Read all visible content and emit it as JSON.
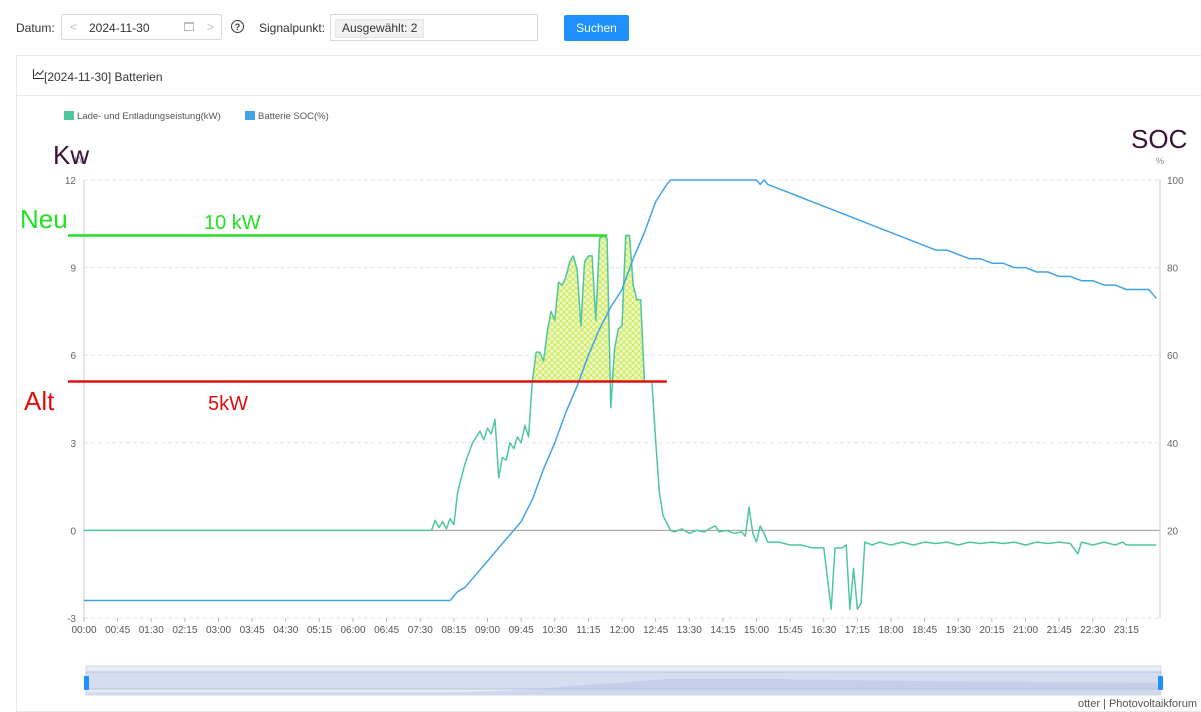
{
  "toolbar": {
    "date_label": "Datum",
    "date_value": "2024-11-30",
    "signal_label": "Signalpunkt",
    "signal_tag": "Ausgewählt: 2",
    "search_button": "Suchen"
  },
  "card": {
    "title": "[2024-11-30] Batterien"
  },
  "footer": "otter | Photovoltaikforum",
  "colors": {
    "power": "#4fc6a0",
    "soc": "#41a4e8",
    "accent_button": "#1e90ff",
    "new_line": "#22e022",
    "old_line": "#e01010",
    "hatch": "#c8e84a"
  },
  "chart_data": {
    "type": "line",
    "legend": [
      "Lade- und Entladungseistung(kW)",
      "Batterie SOC(%)"
    ],
    "legend_position": "top-left",
    "left_axis_units": "kW",
    "right_axis_units": "%",
    "overlay_left_title": "Kw",
    "overlay_right_title": "SOC",
    "ylim_left": [
      -3,
      12
    ],
    "ylim_right": [
      0,
      100
    ],
    "yticks_left": [
      -3,
      0,
      3,
      6,
      9,
      12
    ],
    "yticks_right": [
      20,
      40,
      60,
      80,
      100
    ],
    "xticks": [
      "00:00",
      "00:45",
      "01:30",
      "02:15",
      "03:00",
      "03:45",
      "04:30",
      "05:15",
      "06:00",
      "06:45",
      "07:30",
      "08:15",
      "09:00",
      "09:45",
      "10:30",
      "11:15",
      "12:00",
      "12:45",
      "13:30",
      "14:15",
      "15:00",
      "15:45",
      "16:30",
      "17:15",
      "18:00",
      "18:45",
      "19:30",
      "20:15",
      "21:00",
      "21:45",
      "22:30",
      "23:15"
    ],
    "grid": "horizontal dashed",
    "series": [
      {
        "name": "Lade- und Entladungseistung(kW)",
        "axis": "left",
        "points": [
          [
            "00:00",
            0
          ],
          [
            "07:45",
            0
          ],
          [
            "07:50",
            0.35
          ],
          [
            "07:55",
            0.1
          ],
          [
            "08:00",
            0.3
          ],
          [
            "08:05",
            0.05
          ],
          [
            "08:10",
            0.4
          ],
          [
            "08:15",
            0.2
          ],
          [
            "08:20",
            1.3
          ],
          [
            "08:30",
            2.3
          ],
          [
            "08:40",
            3.0
          ],
          [
            "08:50",
            3.4
          ],
          [
            "08:55",
            3.1
          ],
          [
            "09:00",
            3.5
          ],
          [
            "09:05",
            3.3
          ],
          [
            "09:10",
            3.8
          ],
          [
            "09:15",
            1.8
          ],
          [
            "09:20",
            2.5
          ],
          [
            "09:25",
            2.4
          ],
          [
            "09:30",
            3.0
          ],
          [
            "09:35",
            2.8
          ],
          [
            "09:40",
            3.2
          ],
          [
            "09:45",
            3.0
          ],
          [
            "09:50",
            3.6
          ],
          [
            "09:55",
            3.2
          ],
          [
            "10:00",
            5.1
          ],
          [
            "10:05",
            6.1
          ],
          [
            "10:10",
            6.1
          ],
          [
            "10:15",
            5.8
          ],
          [
            "10:20",
            6.8
          ],
          [
            "10:25",
            7.5
          ],
          [
            "10:30",
            7.2
          ],
          [
            "10:35",
            8.5
          ],
          [
            "10:40",
            8.4
          ],
          [
            "10:45",
            8.7
          ],
          [
            "10:50",
            9.2
          ],
          [
            "10:55",
            9.4
          ],
          [
            "11:00",
            8.9
          ],
          [
            "11:05",
            7.0
          ],
          [
            "11:10",
            9.2
          ],
          [
            "11:15",
            9.4
          ],
          [
            "11:20",
            9.4
          ],
          [
            "11:25",
            7.2
          ],
          [
            "11:30",
            10.0
          ],
          [
            "11:35",
            10.1
          ],
          [
            "11:40",
            10.0
          ],
          [
            "11:45",
            4.2
          ],
          [
            "11:50",
            6.2
          ],
          [
            "11:55",
            6.9
          ],
          [
            "12:00",
            7.0
          ],
          [
            "12:05",
            10.1
          ],
          [
            "12:10",
            10.1
          ],
          [
            "12:15",
            8.4
          ],
          [
            "12:20",
            7.9
          ],
          [
            "12:25",
            7.9
          ],
          [
            "12:30",
            5.1
          ],
          [
            "12:40",
            5.1
          ],
          [
            "12:45",
            3.1
          ],
          [
            "12:50",
            1.3
          ],
          [
            "12:55",
            0.5
          ],
          [
            "13:05",
            0
          ],
          [
            "13:10",
            -0.05
          ],
          [
            "13:20",
            0.05
          ],
          [
            "13:30",
            -0.1
          ],
          [
            "13:40",
            0
          ],
          [
            "13:50",
            -0.05
          ],
          [
            "14:00",
            0.1
          ],
          [
            "14:05",
            0.15
          ],
          [
            "14:10",
            -0.05
          ],
          [
            "14:20",
            0
          ],
          [
            "14:30",
            -0.1
          ],
          [
            "14:40",
            -0.05
          ],
          [
            "14:45",
            -0.2
          ],
          [
            "14:50",
            0.8
          ],
          [
            "14:55",
            -0.1
          ],
          [
            "15:00",
            -0.4
          ],
          [
            "15:05",
            0.15
          ],
          [
            "15:10",
            -0.1
          ],
          [
            "15:15",
            -0.4
          ],
          [
            "15:30",
            -0.4
          ],
          [
            "15:45",
            -0.5
          ],
          [
            "16:00",
            -0.5
          ],
          [
            "16:15",
            -0.6
          ],
          [
            "16:30",
            -0.6
          ],
          [
            "16:40",
            -2.7
          ],
          [
            "16:45",
            -0.6
          ],
          [
            "16:55",
            -0.6
          ],
          [
            "17:00",
            -0.5
          ],
          [
            "17:05",
            -2.7
          ],
          [
            "17:10",
            -1.3
          ],
          [
            "17:15",
            -2.7
          ],
          [
            "17:20",
            -2.5
          ],
          [
            "17:25",
            -0.4
          ],
          [
            "17:35",
            -0.5
          ],
          [
            "17:45",
            -0.4
          ],
          [
            "18:00",
            -0.5
          ],
          [
            "18:15",
            -0.4
          ],
          [
            "18:30",
            -0.5
          ],
          [
            "18:45",
            -0.4
          ],
          [
            "19:00",
            -0.45
          ],
          [
            "19:15",
            -0.4
          ],
          [
            "19:30",
            -0.5
          ],
          [
            "19:45",
            -0.4
          ],
          [
            "20:00",
            -0.45
          ],
          [
            "20:15",
            -0.4
          ],
          [
            "20:30",
            -0.45
          ],
          [
            "20:45",
            -0.4
          ],
          [
            "21:00",
            -0.5
          ],
          [
            "21:15",
            -0.4
          ],
          [
            "21:30",
            -0.45
          ],
          [
            "21:45",
            -0.4
          ],
          [
            "22:00",
            -0.45
          ],
          [
            "22:10",
            -0.8
          ],
          [
            "22:15",
            -0.4
          ],
          [
            "22:30",
            -0.5
          ],
          [
            "22:45",
            -0.4
          ],
          [
            "23:00",
            -0.5
          ],
          [
            "23:10",
            -0.4
          ],
          [
            "23:15",
            -0.5
          ],
          [
            "23:30",
            -0.5
          ],
          [
            "23:55",
            -0.5
          ]
        ]
      },
      {
        "name": "Batterie SOC(%)",
        "axis": "right",
        "points": [
          [
            "00:00",
            4
          ],
          [
            "08:10",
            4
          ],
          [
            "08:20",
            6
          ],
          [
            "08:30",
            7
          ],
          [
            "08:45",
            10
          ],
          [
            "09:00",
            13
          ],
          [
            "09:15",
            16
          ],
          [
            "09:30",
            19
          ],
          [
            "09:45",
            22
          ],
          [
            "10:00",
            27
          ],
          [
            "10:15",
            34
          ],
          [
            "10:30",
            40
          ],
          [
            "10:45",
            47
          ],
          [
            "11:00",
            53
          ],
          [
            "11:15",
            60
          ],
          [
            "11:30",
            66
          ],
          [
            "11:45",
            71
          ],
          [
            "12:00",
            75
          ],
          [
            "12:15",
            82
          ],
          [
            "12:30",
            88
          ],
          [
            "12:45",
            95
          ],
          [
            "13:00",
            99
          ],
          [
            "13:05",
            100
          ],
          [
            "14:00",
            100
          ],
          [
            "15:00",
            100
          ],
          [
            "15:05",
            99
          ],
          [
            "15:10",
            100
          ],
          [
            "15:15",
            99
          ],
          [
            "15:30",
            98
          ],
          [
            "15:45",
            97
          ],
          [
            "16:00",
            96
          ],
          [
            "16:15",
            95
          ],
          [
            "16:30",
            94
          ],
          [
            "16:45",
            93
          ],
          [
            "17:00",
            92
          ],
          [
            "17:15",
            91
          ],
          [
            "17:30",
            90
          ],
          [
            "17:45",
            89
          ],
          [
            "18:00",
            88
          ],
          [
            "18:15",
            87
          ],
          [
            "18:30",
            86
          ],
          [
            "18:45",
            85
          ],
          [
            "19:00",
            84
          ],
          [
            "19:15",
            84
          ],
          [
            "19:30",
            83
          ],
          [
            "19:45",
            82
          ],
          [
            "20:00",
            82
          ],
          [
            "20:15",
            81
          ],
          [
            "20:30",
            81
          ],
          [
            "20:45",
            80
          ],
          [
            "21:00",
            80
          ],
          [
            "21:15",
            79
          ],
          [
            "21:30",
            79
          ],
          [
            "21:45",
            78
          ],
          [
            "22:00",
            78
          ],
          [
            "22:15",
            77
          ],
          [
            "22:30",
            77
          ],
          [
            "22:45",
            76
          ],
          [
            "23:00",
            76
          ],
          [
            "23:15",
            75
          ],
          [
            "23:30",
            75
          ],
          [
            "23:45",
            75
          ],
          [
            "23:55",
            73
          ]
        ]
      }
    ],
    "annotations": [
      {
        "text": "Neu",
        "value_label": "10 kW",
        "kw": 10.1,
        "from": "00:00",
        "to": "11:40",
        "color": "#22e022"
      },
      {
        "text": "Alt",
        "value_label": "5kW",
        "kw": 5.1,
        "from": "00:00",
        "to": "13:00",
        "color": "#e01010"
      }
    ],
    "hatched_region": {
      "above_kw": 5.1,
      "from": "10:00",
      "to": "12:40",
      "color": "#c8e84a"
    },
    "zoom_slider": {
      "start_percent": 0,
      "end_percent": 100
    }
  }
}
